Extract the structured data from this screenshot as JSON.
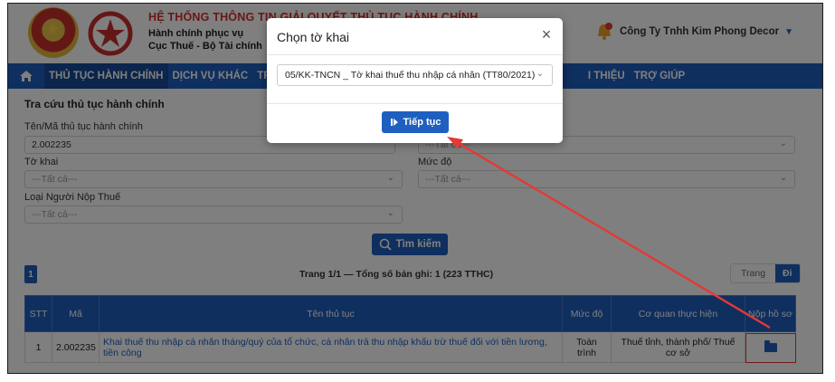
{
  "header": {
    "title": "HỆ THỐNG THÔNG TIN GIẢI QUYẾT THỦ TỤC HÀNH CHÍNH",
    "subtitle_line1": "Hành chính phục vụ",
    "subtitle_line2": "Cục Thuế - Bộ Tài chính",
    "user_name": "Công Ty Tnhh Kim Phong Decor"
  },
  "nav": {
    "items": [
      "THỦ TỤC HÀNH CHÍNH",
      "DỊCH VỤ KHÁC",
      "TRA",
      "I THIỆU",
      "TRỢ GIÚP"
    ]
  },
  "search": {
    "panel_title": "Tra cứu thủ tục hành chính",
    "code_label": "Tên/Mã thủ tục hành chính",
    "code_value": "2.002235",
    "right_top_placeholder": "---Tất cả---",
    "declaration_label": "Tờ khai",
    "declaration_placeholder": "---Tất cả---",
    "level_label": "Mức độ",
    "level_placeholder": "---Tất cả---",
    "taxpayer_type_label": "Loại Người Nộp Thuế",
    "taxpayer_type_placeholder": "---Tất cả---",
    "search_button": "Tìm kiếm"
  },
  "pagination": {
    "current_page": "1",
    "summary": "Trang 1/1 — Tổng số bản ghi: 1 (223 TTHC)",
    "goto_label": "Trang",
    "goto_button": "Đi"
  },
  "table": {
    "columns": [
      "STT",
      "Mã",
      "Tên thủ tục",
      "Mức độ",
      "Cơ quan thực hiện",
      "Nộp hồ sơ"
    ],
    "rows": [
      {
        "stt": "1",
        "code": "2.002235",
        "name": "Khai thuế thu nhập cá nhân tháng/quý của tổ chức, cá nhân trả thu nhập khấu trừ thuế đối với tiền lương, tiền công",
        "level": "Toàn trình",
        "agency": "Thuế tỉnh, thành phố/ Thuế cơ sở"
      }
    ]
  },
  "modal": {
    "title": "Chọn tờ khai",
    "selected_option": "05/KK-TNCN _ Tờ khai thuế thu nhập cá nhân (TT80/2021)",
    "continue_button": "Tiếp tục"
  },
  "colors": {
    "primary": "#1f5fbf",
    "title_red": "#d3302a",
    "annotation_red": "#e53935"
  }
}
